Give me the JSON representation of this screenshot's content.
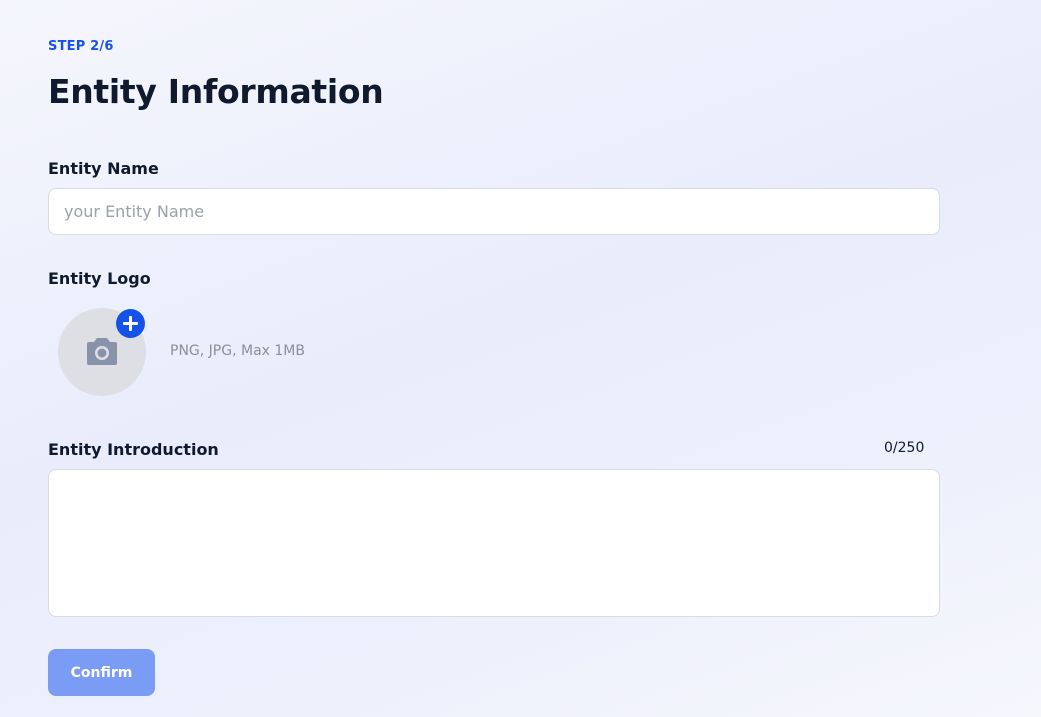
{
  "step": {
    "label": "STEP 2/6"
  },
  "page": {
    "title": "Entity Information"
  },
  "name_field": {
    "label": "Entity Name",
    "placeholder": "your Entity Name",
    "value": ""
  },
  "logo_field": {
    "label": "Entity Logo",
    "hint": "PNG, JPG, Max 1MB",
    "icon": "camera-icon",
    "badge_icon": "plus-icon"
  },
  "intro_field": {
    "label": "Entity Introduction",
    "counter": "0/250",
    "value": ""
  },
  "actions": {
    "confirm_label": "Confirm"
  },
  "colors": {
    "accent": "#1652e8",
    "confirm_disabled": "#7b9cf4",
    "title": "#0f1a2e"
  }
}
